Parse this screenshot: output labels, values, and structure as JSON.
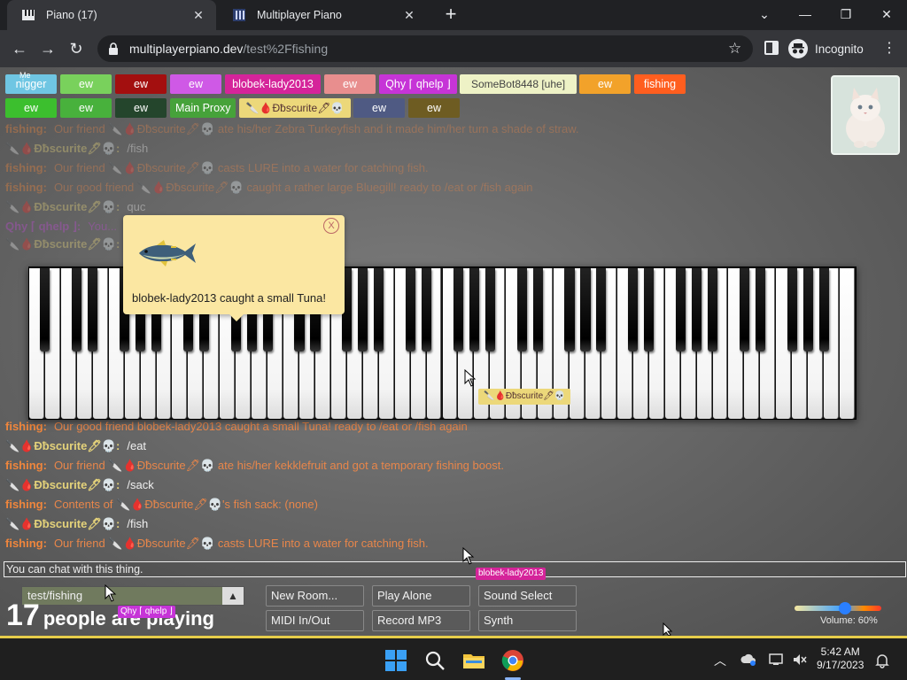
{
  "browser": {
    "tabs": [
      {
        "title": "Piano (17)",
        "active": true
      },
      {
        "title": "Multiplayer Piano",
        "active": false
      }
    ],
    "url_host": "multiplayerpiano.dev",
    "url_path": "/test%2Ffishing",
    "incognito_label": "Incognito"
  },
  "user_tags": [
    {
      "label": "nigger",
      "small_label": "Me",
      "color": "#6fc6e3"
    },
    {
      "label": "ew",
      "color": "#79d15c"
    },
    {
      "label": "ew",
      "color": "#a30f0f"
    },
    {
      "label": "ew",
      "color": "#cf59e6"
    },
    {
      "label": "blobek-lady2013",
      "color": "#d5249a"
    },
    {
      "label": "ew",
      "color": "#e88e8e"
    },
    {
      "label": "Qhy ⌈ qhelp ⌋",
      "color": "#c634d7"
    },
    {
      "label": "SomeBot8448 [uhe]",
      "color": "#eef2c6",
      "text_color": "#444"
    },
    {
      "label": "ew",
      "color": "#f2a22a"
    },
    {
      "label": "fishing",
      "color": "#ff5e1f"
    },
    {
      "label": "ew",
      "color": "#3cbf2e"
    },
    {
      "label": "ew",
      "color": "#48b13c"
    },
    {
      "label": "ew",
      "color": "#24452c"
    },
    {
      "label": "Main Proxy",
      "color": "#46a23a"
    },
    {
      "label": "🔪🩸Ɖƀscurite🖊💀",
      "color": "#ecd87a",
      "text_color": "#533"
    },
    {
      "label": "ew",
      "color": "#4f5a83"
    },
    {
      "label": "ew",
      "color": "#6e5c22"
    }
  ],
  "chat": [
    {
      "nick": "fishing:",
      "nick_color": "#f0863c",
      "text": "Our friend 🔪🩸Ɖƀscurite🖊💀 ate his/her Zebra Turkeyfish and it made him/her turn a shade of straw.",
      "color": "#e8864a",
      "faded": true
    },
    {
      "nick": "🔪🩸Ɖƀscurite🖊💀:",
      "nick_color": "#e4d27a",
      "text": "/fish",
      "color": "#f0f0f0",
      "faded": true
    },
    {
      "nick": "fishing:",
      "nick_color": "#f0863c",
      "text": "Our friend 🔪🩸Ɖƀscurite🖊💀 casts LURE into a water for catching fish.",
      "color": "#e8864a",
      "faded": true
    },
    {
      "nick": "fishing:",
      "nick_color": "#f0863c",
      "text": "Our good friend 🔪🩸Ɖƀscurite🖊💀 caught a rather large Bluegill! ready to /eat or /fish again",
      "color": "#e8864a",
      "faded": true
    },
    {
      "nick": "🔪🩸Ɖƀscurite🖊💀:",
      "nick_color": "#e4d27a",
      "text": "quc",
      "color": "#f0f0f0",
      "faded": true
    },
    {
      "nick": "Qhy ⌈ qhelp ⌋:",
      "nick_color": "#c04ad6",
      "text": "You...",
      "color": "#c04ad6",
      "faded": true
    },
    {
      "nick": "🔪🩸Ɖƀscurite🖊💀:",
      "nick_color": "#e4d27a",
      "text": "",
      "color": "#f0f0f0",
      "faded": true
    },
    {
      "nick": "fishing:",
      "nick_color": "#f0863c",
      "text": "Our good friend blobek-lady2013 caught a small Tuna! ready to /eat or /fish again",
      "color": "#e8864a",
      "faded": false
    },
    {
      "nick": "🔪🩸Ɖƀscurite🖊💀:",
      "nick_color": "#e4d27a",
      "text": "/eat",
      "color": "#f0f0f0",
      "faded": false
    },
    {
      "nick": "fishing:",
      "nick_color": "#f0863c",
      "text": "Our friend 🔪🩸Ɖƀscurite🖊💀 ate his/her kekklefruit and got a temporary fishing boost.",
      "color": "#e8864a",
      "faded": false
    },
    {
      "nick": "🔪🩸Ɖƀscurite🖊💀:",
      "nick_color": "#e4d27a",
      "text": "/sack",
      "color": "#f0f0f0",
      "faded": false
    },
    {
      "nick": "fishing:",
      "nick_color": "#f0863c",
      "text": "Contents of 🔪🩸Ɖƀscurite🖊💀's fish sack: (none)",
      "color": "#e8864a",
      "faded": false
    },
    {
      "nick": "🔪🩸Ɖƀscurite🖊💀:",
      "nick_color": "#e4d27a",
      "text": "/fish",
      "color": "#f0f0f0",
      "faded": false
    },
    {
      "nick": "fishing:",
      "nick_color": "#f0863c",
      "text": "Our friend 🔪🩸Ɖƀscurite🖊💀 casts LURE into a water for catching fish.",
      "color": "#e8864a",
      "faded": false
    }
  ],
  "notification": {
    "text": "blobek-lady2013 caught a small Tuna!",
    "close_label": "X"
  },
  "piano_cursor_tag": {
    "label": "🔪🩸Ɖƀscurite🖊💀",
    "color": "#ecd87a"
  },
  "chat_input": {
    "placeholder": "You can chat with this thing."
  },
  "cursor_tags": [
    {
      "label": "blobek-lady2013",
      "color": "#d5249a"
    },
    {
      "label": "Qhy ⌈ qhelp ⌋",
      "color": "#c634d7"
    }
  ],
  "room": {
    "name": "test/fishing"
  },
  "players": {
    "count": "17",
    "label": "people are playing"
  },
  "controls": {
    "new_room": "New Room...",
    "play_alone": "Play Alone",
    "sound_select": "Sound Select",
    "midi": "MIDI In/Out",
    "record": "Record MP3",
    "synth": "Synth"
  },
  "volume": {
    "label": "Volume: 60%",
    "value": 0.6
  },
  "taskbar": {
    "time": "5:42 AM",
    "date": "9/17/2023"
  }
}
